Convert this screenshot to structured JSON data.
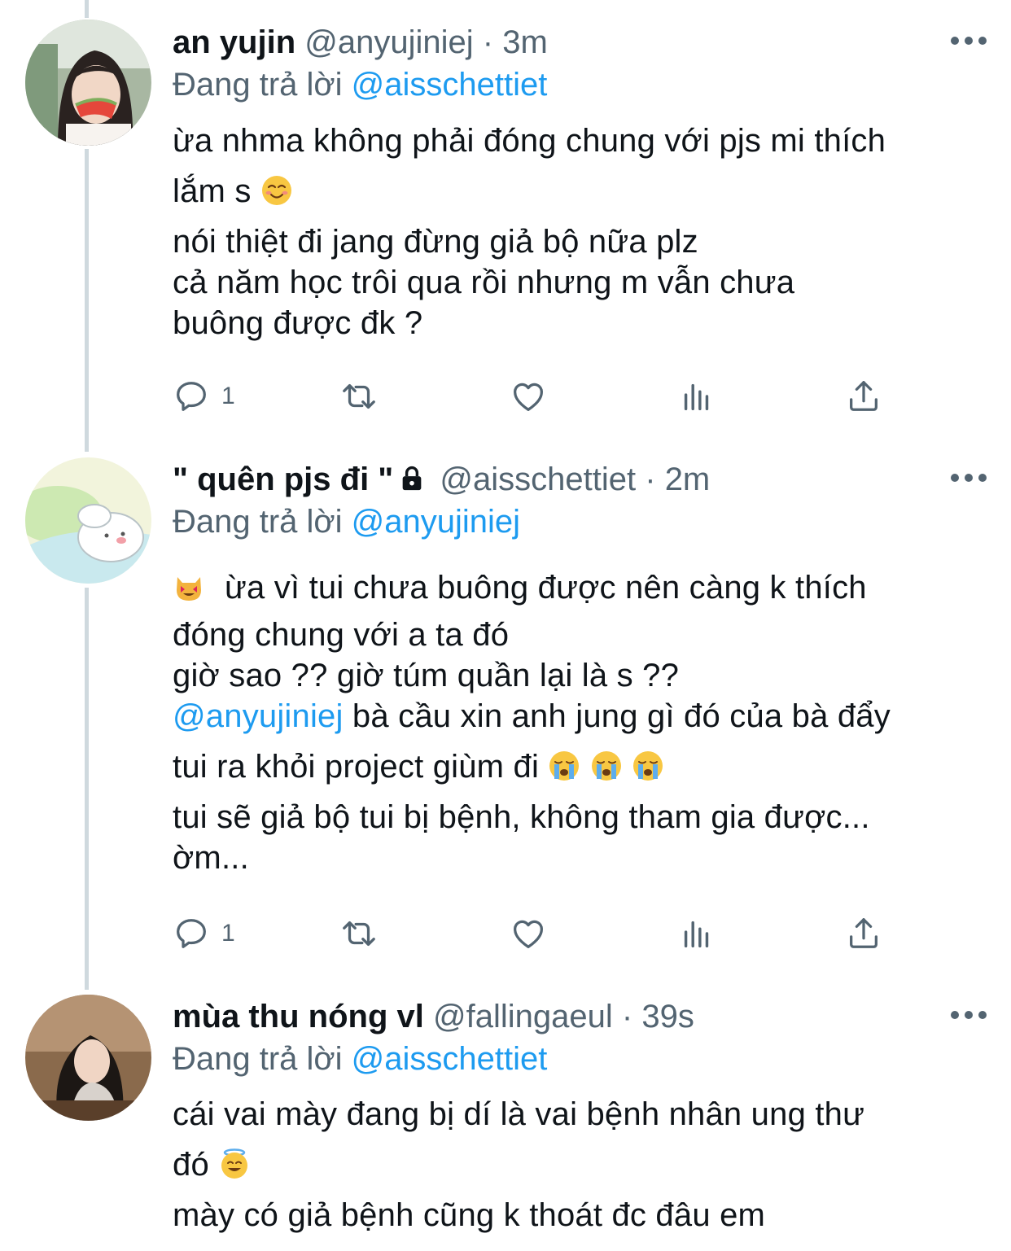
{
  "tweets": [
    {
      "name": "an yujin",
      "handle": "@anyujiniej",
      "dot": "·",
      "time": "3m",
      "replying_prefix": "Đang trả lời",
      "replying_to": "@aisschettiet",
      "lines": [
        "ừa nhma không phải đóng chung với pjs mi thích",
        "lắm s",
        "nói thiệt đi jang đừng giả bộ nữa plz",
        "cả năm học trôi qua rồi nhưng m vẫn chưa",
        "buông được đk ?"
      ],
      "reply_count": "1"
    },
    {
      "name": "\" quên pjs đi \"",
      "handle": "@aisschettiet",
      "dot": "·",
      "time": "2m",
      "replying_prefix": "Đang trả lời",
      "replying_to": "@anyujiniej",
      "lines": [
        "ừa vì tui chưa buông được nên càng k thích",
        "đóng chung với a ta đó",
        "giờ sao ?? giờ túm quần lại là s ??",
        "@anyujiniej",
        "bà cầu xin anh jung gì đó của bà đẩy",
        "tui ra khỏi project giùm đi",
        "tui sẽ giả bộ tui bị bệnh, không tham gia được...",
        "ờm..."
      ],
      "reply_count": "1"
    },
    {
      "name": "mùa thu nóng vl",
      "handle": "@fallingaeul",
      "dot": "·",
      "time": "39s",
      "replying_prefix": "Đang trả lời",
      "replying_to": "@aisschettiet",
      "lines": [
        "cái vai mày đang bị dí là vai bệnh nhân ung thư",
        "đó",
        "mày có giả bệnh cũng k thoát đc đâu em"
      ]
    }
  ],
  "icons": {
    "reply": "reply-icon",
    "retweet": "retweet-icon",
    "like": "like-icon",
    "analytics": "analytics-icon",
    "share": "share-icon",
    "more": "more-icon",
    "lock": "lock-icon"
  },
  "colors": {
    "link": "#1d9bf0",
    "secondary_text": "#536471",
    "thread_line": "#cfd9de"
  }
}
